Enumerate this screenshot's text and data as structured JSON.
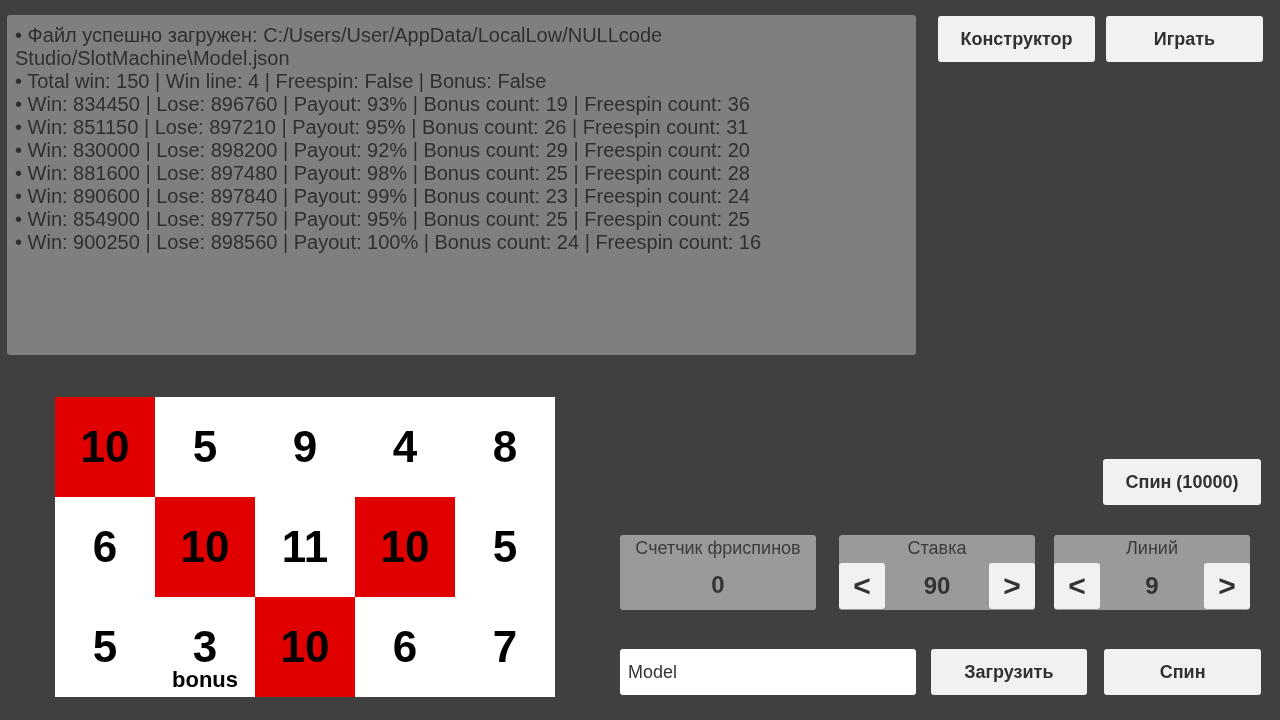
{
  "log": [
    "• Файл успешно загружен: C:/Users/User/AppData/LocalLow/NULLcode Studio/SlotMachine\\Model.json",
    "• Total win: 150 | Win line: 4 | Freespin: False | Bonus: False",
    "• Win: 834450 | Lose: 896760 | Payout: 93% | Bonus count: 19 | Freespin count: 36",
    "• Win: 851150 | Lose: 897210 | Payout: 95% | Bonus count: 26 | Freespin count: 31",
    "• Win: 830000 | Lose: 898200 | Payout: 92% | Bonus count: 29 | Freespin count: 20",
    "• Win: 881600 | Lose: 897480 | Payout: 98% | Bonus count: 25 | Freespin count: 28",
    "• Win: 890600 | Lose: 897840 | Payout: 99% | Bonus count: 23 | Freespin count: 24",
    "• Win: 854900 | Lose: 897750 | Payout: 95% | Bonus count: 25 | Freespin count: 25",
    "• Win: 900250 | Lose: 898560 | Payout: 100% | Bonus count: 24 | Freespin count: 16"
  ],
  "top_buttons": [
    "Конструктор",
    "Играть"
  ],
  "reels": [
    [
      {
        "value": "10",
        "highlighted": true
      },
      {
        "value": "5",
        "highlighted": false
      },
      {
        "value": "9",
        "highlighted": false
      },
      {
        "value": "4",
        "highlighted": false
      },
      {
        "value": "8",
        "highlighted": false
      }
    ],
    [
      {
        "value": "6",
        "highlighted": false
      },
      {
        "value": "10",
        "highlighted": true
      },
      {
        "value": "11",
        "highlighted": false
      },
      {
        "value": "10",
        "highlighted": true
      },
      {
        "value": "5",
        "highlighted": false
      }
    ],
    [
      {
        "value": "5",
        "highlighted": false
      },
      {
        "value": "3",
        "highlighted": false,
        "tag": "bonus"
      },
      {
        "value": "10",
        "highlighted": true
      },
      {
        "value": "6",
        "highlighted": false
      },
      {
        "value": "7",
        "highlighted": false
      }
    ]
  ],
  "spin_many_button": "Спин (10000)",
  "freespin_counter": {
    "label": "Счетчик фриспинов",
    "value": "0"
  },
  "steppers": [
    {
      "label": "Ставка",
      "value": "90",
      "dec": "<",
      "inc": ">"
    },
    {
      "label": "Линий",
      "value": "9",
      "dec": "<",
      "inc": ">"
    }
  ],
  "model_field": {
    "value": "Model"
  },
  "load_button": "Загрузить",
  "spin_button": "Спин"
}
